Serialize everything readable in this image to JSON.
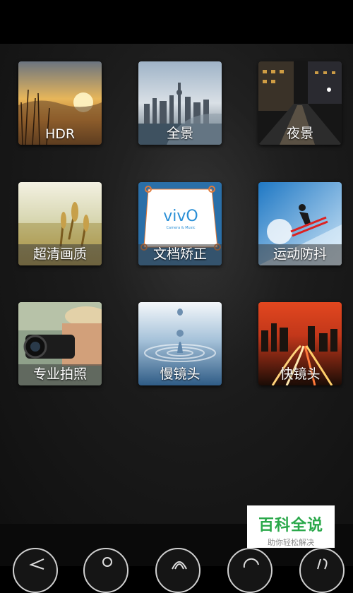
{
  "modes": [
    {
      "id": "hdr",
      "label": "HDR",
      "icon": "sunset-field-thumbnail"
    },
    {
      "id": "panorama",
      "label": "全景",
      "icon": "city-skyline-thumbnail"
    },
    {
      "id": "night",
      "label": "夜景",
      "icon": "night-street-thumbnail"
    },
    {
      "id": "hd",
      "label": "超清画质",
      "icon": "wheat-field-thumbnail"
    },
    {
      "id": "doc",
      "label": "文档矫正",
      "icon": "document-thumbnail",
      "doc_brand": "vivO",
      "doc_sub": "Camera & Music"
    },
    {
      "id": "sport",
      "label": "运动防抖",
      "icon": "skier-thumbnail"
    },
    {
      "id": "pro",
      "label": "专业拍照",
      "icon": "photographer-thumbnail"
    },
    {
      "id": "slow",
      "label": "慢镜头",
      "icon": "water-drop-thumbnail"
    },
    {
      "id": "fast",
      "label": "快镜头",
      "icon": "light-trails-thumbnail"
    }
  ],
  "watermark": {
    "title": "百科全说",
    "subtitle": "助你轻松解决"
  },
  "bottom_nav": [
    "mode-icon",
    "person-icon",
    "fingerprint-icon",
    "switch-camera-icon",
    "settings-icon"
  ],
  "colors": {
    "accent_green": "#2aa84a",
    "background": "#000000"
  }
}
